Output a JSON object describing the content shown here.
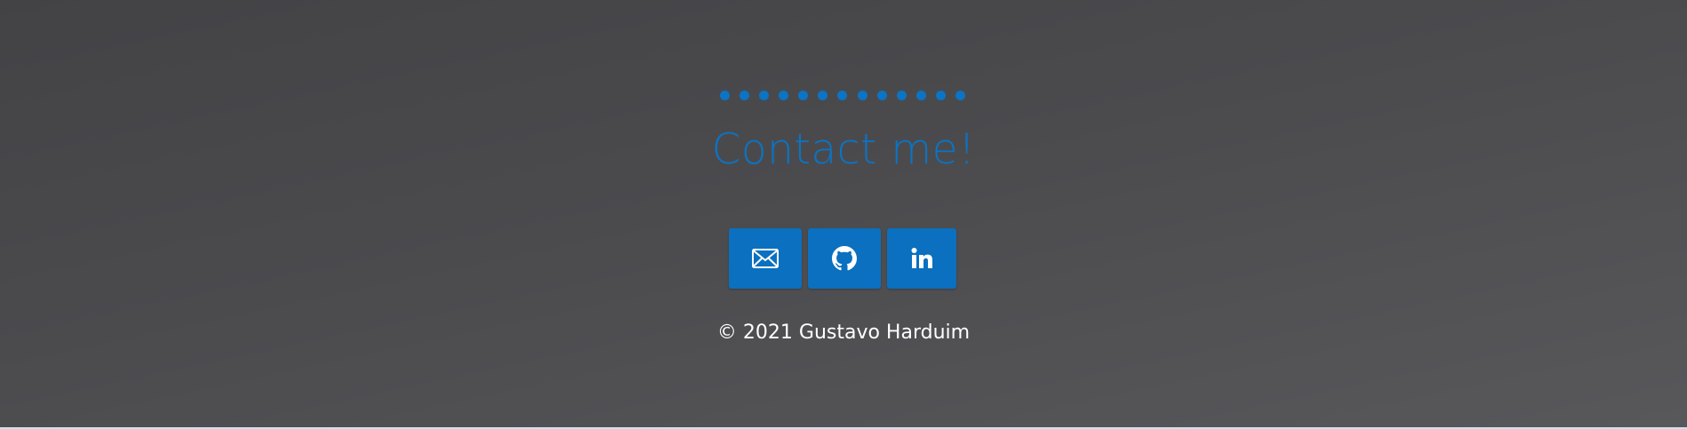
{
  "footer": {
    "title": "Contact me!",
    "dot_count": 13,
    "accent_color": "#0b74c4",
    "links": [
      {
        "name": "email",
        "icon": "envelope-icon"
      },
      {
        "name": "github",
        "icon": "github-icon"
      },
      {
        "name": "linkedin",
        "icon": "linkedin-icon"
      }
    ],
    "copyright": "© 2021 Gustavo Harduim"
  }
}
